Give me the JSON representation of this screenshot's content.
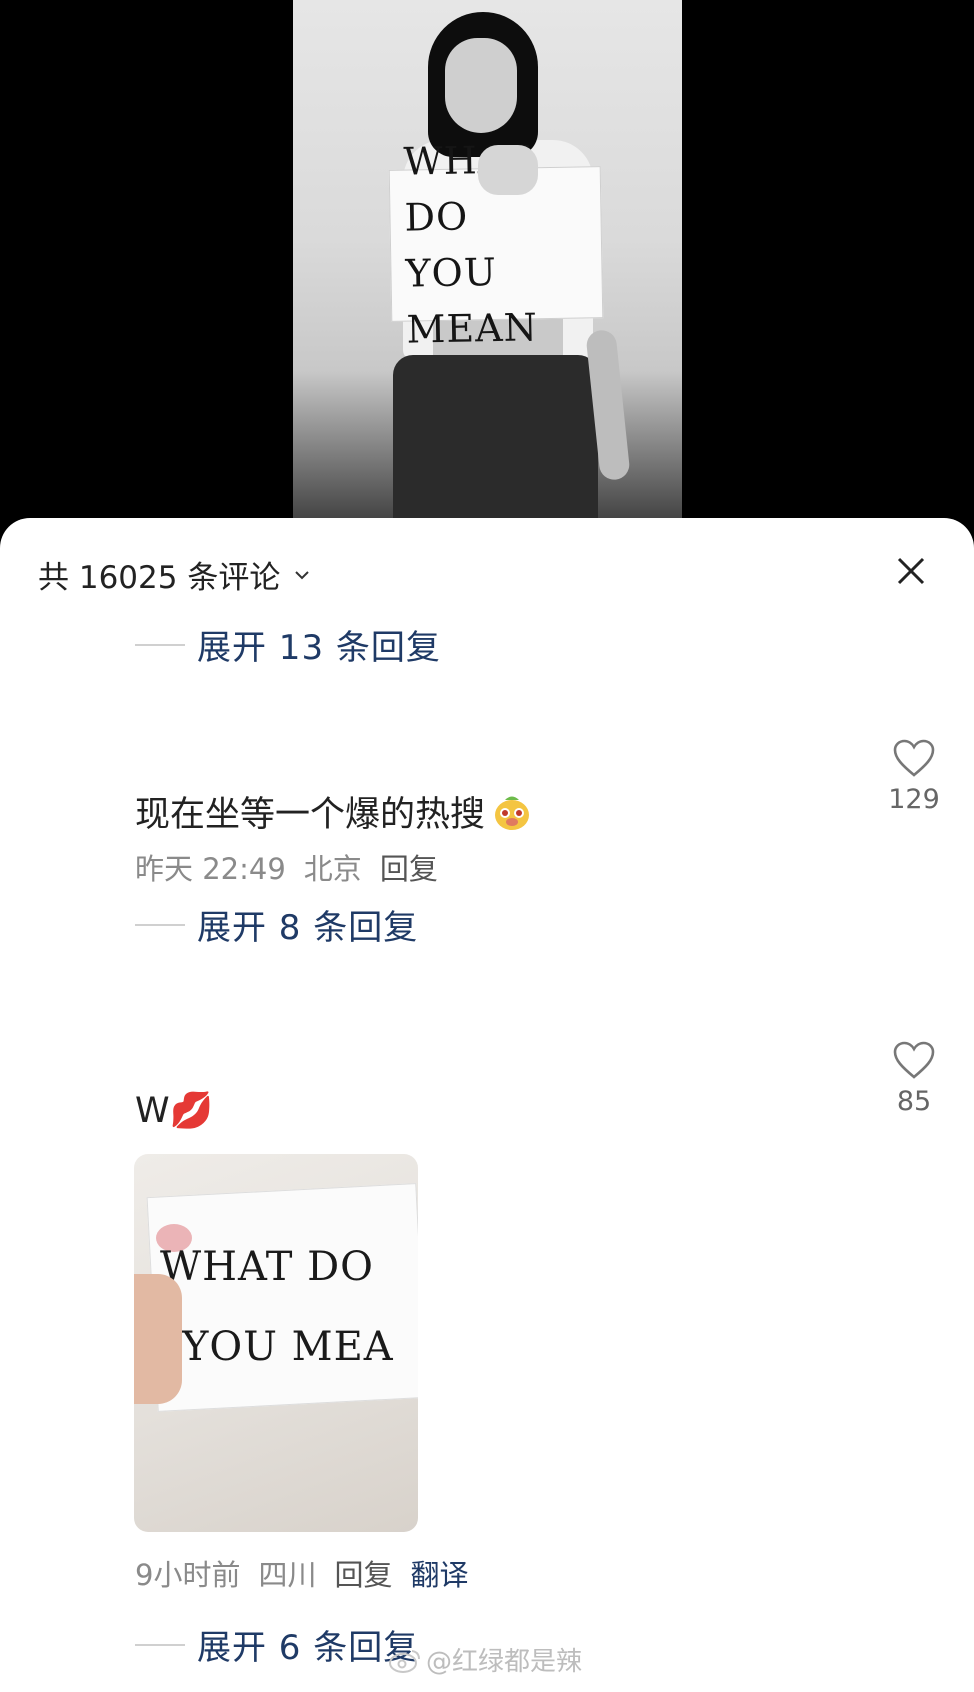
{
  "sheet": {
    "comment_count_label": "共 16025 条评论"
  },
  "video": {
    "sign_line_1": "WHAT DO",
    "sign_line_2": "YOU MEAN"
  },
  "threads": [
    {
      "expand_label": "展开 13 条回复"
    },
    {
      "text": "现在坐等一个爆的热搜",
      "time": "昨天 22:49",
      "location": "北京",
      "reply_label": "回复",
      "like_count": "129",
      "expand_label": "展开 8 条回复"
    },
    {
      "text": "W💋",
      "image_line_1": "WHAT DO",
      "image_line_2": "YOU MEA",
      "time": "9小时前",
      "location": "四川",
      "reply_label": "回复",
      "translate_label": "翻译",
      "like_count": "85",
      "expand_label": "展开 6 条回复"
    }
  ],
  "watermark": "@红绿都是辣",
  "colors": {
    "expand_link": "#1f3a66",
    "meta_gray": "#8a8a8a",
    "sheet_bg": "#ffffff"
  },
  "icons": [
    "chevron-down-icon",
    "close-icon",
    "heart-icon",
    "mascot-emoji-icon",
    "weibo-logo-icon"
  ]
}
